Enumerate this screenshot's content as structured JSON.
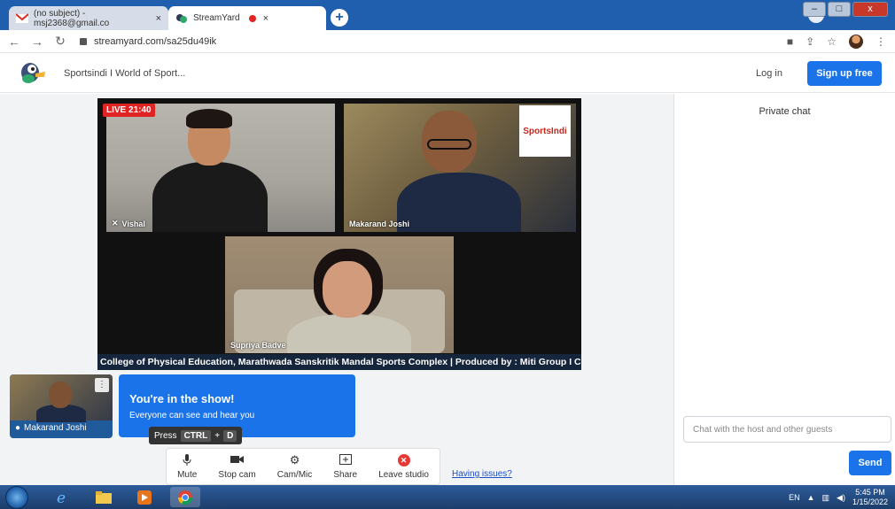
{
  "browser": {
    "tabs": [
      {
        "title": "(no subject) - msj2368@gmail.co",
        "close": "×"
      },
      {
        "title": "StreamYard",
        "close": "×"
      }
    ],
    "new_tab": "+",
    "url": "streamyard.com/sa25du49ik",
    "window_buttons": {
      "minimize": "–",
      "maximize": "□",
      "close": "x"
    },
    "chevron": "⌄"
  },
  "header": {
    "title": "Sportsindi I World of Sport...",
    "login": "Log in",
    "signup": "Sign up free"
  },
  "stage": {
    "live_badge": "LIVE 21:40",
    "participants": [
      {
        "name": "Vishal",
        "muted": true
      },
      {
        "name": "Makarand Joshi",
        "muted": false
      },
      {
        "name": "Supriya Badve",
        "muted": false
      }
    ],
    "logo_text": "SportsIndi",
    "ticker": "College of Physical Education, Marathwada Sanskritik Mandal Sports Complex | Produced by : Miti Group I C"
  },
  "self_cam": {
    "name": "Makarand Joshi",
    "menu": "⋮"
  },
  "show_card": {
    "title": "You're in the show!",
    "subtitle": "Everyone can see and hear you"
  },
  "tooltip": {
    "prefix": "Press",
    "key1": "CTRL",
    "plus": "+",
    "key2": "D"
  },
  "controls": [
    {
      "label": "Mute",
      "icon": "mic-icon"
    },
    {
      "label": "Stop cam",
      "icon": "camera-icon"
    },
    {
      "label": "Cam/Mic",
      "icon": "gear-icon"
    },
    {
      "label": "Share",
      "icon": "share-screen-icon"
    },
    {
      "label": "Leave studio",
      "icon": "leave-icon"
    }
  ],
  "having_issues": "Having issues?",
  "chat": {
    "title": "Private chat",
    "placeholder": "Chat with the host and other guests",
    "send": "Send"
  },
  "taskbar": {
    "lang": "EN",
    "time": "5:45 PM",
    "date": "1/15/2022"
  },
  "colors": {
    "accent": "#1a73e8",
    "live": "#e02424",
    "ticker_bg": "#15253c",
    "tabbar": "#1f5fae"
  }
}
